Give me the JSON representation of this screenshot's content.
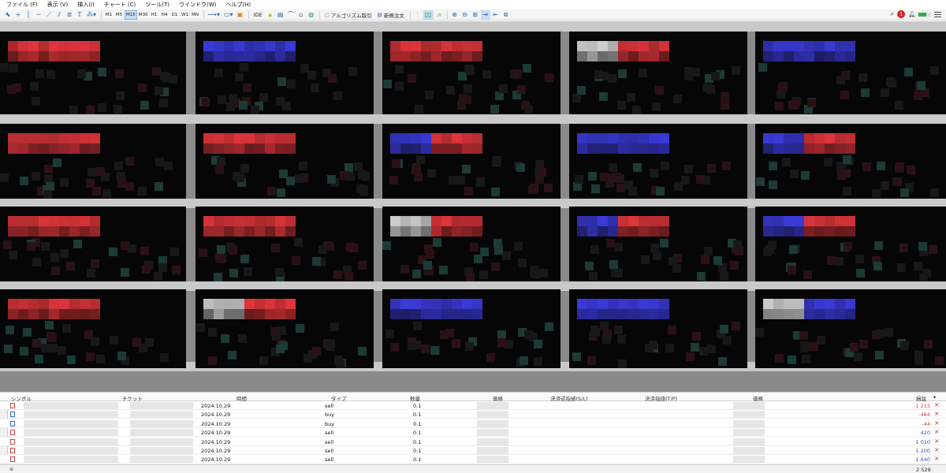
{
  "menu": [
    "ファイル (F)",
    "表示 (V)",
    "挿入(I)",
    "チャート (C)",
    "ツール(T)",
    "ウインドウ(W)",
    "ヘルプ(H)"
  ],
  "toolbar": {
    "timeframes": [
      "M1",
      "M5",
      "M15",
      "M30",
      "H1",
      "H4",
      "D1",
      "W1",
      "MN"
    ],
    "active_timeframe": "M15",
    "ide_label": "IDE",
    "algo_label": "アルゴリズム取引",
    "new_order_label": "新規注文",
    "alert_count": "1"
  },
  "terminal": {
    "columns": {
      "symbol": "シンボル",
      "ticket": "チケット",
      "time": "時間",
      "type": "タイプ",
      "volume": "数量",
      "price_open": "価格",
      "sl": "決済逆指値(S/L)",
      "tp": "決済指値(T/P)",
      "price_current": "価格",
      "profit": "損益"
    },
    "rows": [
      {
        "time": "2024.10.29",
        "type": "sell",
        "volume": "0.1",
        "profit": "-1 213",
        "profit_color": "#e23a3a"
      },
      {
        "time": "2024.10.29",
        "type": "buy",
        "volume": "0.1",
        "profit": "-484",
        "profit_color": "#e23a3a"
      },
      {
        "time": "2024.10.29",
        "type": "buy",
        "volume": "0.1",
        "profit": "-44",
        "profit_color": "#e23a3a"
      },
      {
        "time": "2024.10.29",
        "type": "sell",
        "volume": "0.1",
        "profit": "420",
        "profit_color": "#2f4fc4"
      },
      {
        "time": "2024.10.29",
        "type": "sell",
        "volume": "0.1",
        "profit": "1 010",
        "profit_color": "#2f4fc4"
      },
      {
        "time": "2024.10.29",
        "type": "sell",
        "volume": "0.1",
        "profit": "1 200",
        "profit_color": "#2f4fc4"
      },
      {
        "time": "2024.10.29",
        "type": "sell",
        "volume": "0.1",
        "profit": "1 640",
        "profit_color": "#2f4fc4"
      }
    ],
    "total_profit": "2 529"
  },
  "charts": {
    "grid": "4 rows × 5 columns",
    "header_colors": [
      [
        "red",
        "blue",
        "red",
        "white-red",
        "blue"
      ],
      [
        "red",
        "red",
        "blue-red",
        "blue",
        "blue-red"
      ],
      [
        "red",
        "red",
        "white-red",
        "blue-red",
        "blue-red"
      ],
      [
        "red",
        "white-red",
        "blue",
        "blue",
        "white-blue"
      ]
    ],
    "colors": {
      "red": "#e0363b",
      "blue": "#3b3bdc",
      "white": "#d8d8d8",
      "background": "#060606",
      "accent": "#2a6ab0"
    }
  }
}
